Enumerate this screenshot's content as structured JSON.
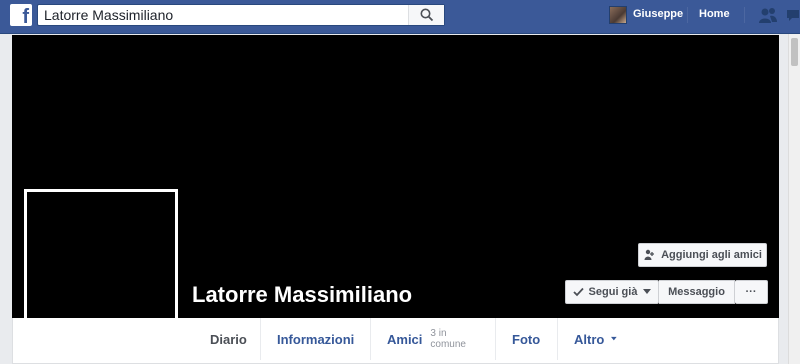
{
  "header": {
    "logo_letter": "f",
    "search_value": "Latorre Massimiliano",
    "user_name": "Giuseppe",
    "home_label": "Home",
    "brand_color": "#3b5998"
  },
  "profile": {
    "name": "Latorre Massimiliano"
  },
  "actions": {
    "add_friend_label": "Aggiungi agli amici",
    "follow_label": "Segui già",
    "message_label": "Messaggio",
    "more_label": "···"
  },
  "tabs": [
    {
      "label": "Diario",
      "active": true
    },
    {
      "label": "Informazioni"
    },
    {
      "label": "Amici",
      "sub": "3 in comune"
    },
    {
      "label": "Foto"
    },
    {
      "label": "Altro"
    }
  ]
}
